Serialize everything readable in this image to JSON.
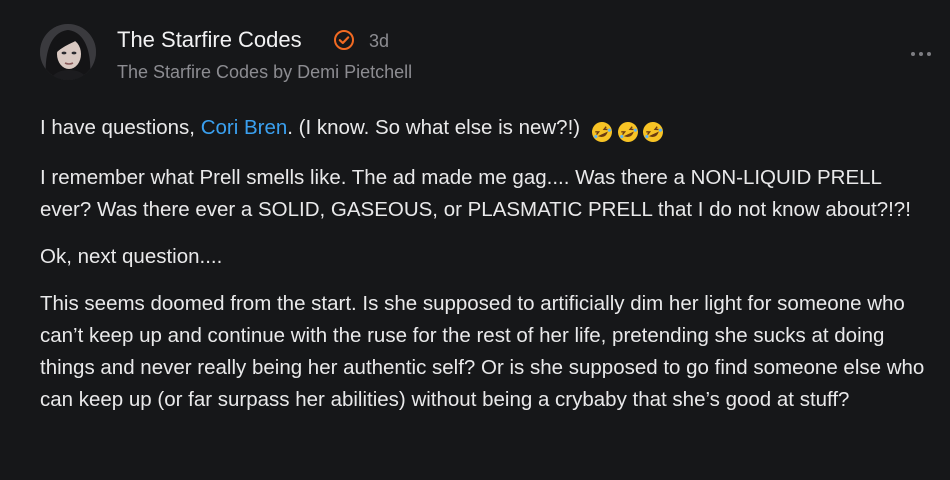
{
  "note": {
    "author": "The Starfire Codes",
    "timestamp": "3d",
    "byline": "The Starfire Codes by Demi Pietchell",
    "verified_color": "#f26a22",
    "menu_icon": "more-horizontal-icon"
  },
  "body": {
    "p1_prefix": "I have questions, ",
    "p1_mention": "Cori Bren",
    "p1_suffix": ". (I know. So what else is new?!)",
    "p1_emoji": "rolling-on-the-floor-laughing x3",
    "p2": "I remember what Prell smells like. The ad made me gag.... Was there a NON-LIQUID PRELL ever? Was there ever a SOLID, GASEOUS, or PLASMATIC PRELL that I do not know about?!?!",
    "p3": "Ok, next question....",
    "p4": "This seems doomed from the start. Is she supposed to artificially dim her light for someone who can’t keep up and continue with the ruse for the rest of her life, pretending she sucks at doing things and never really being her authentic self? Or is she supposed to go find someone else who can keep up (or far surpass her abilities) without being a crybaby that she’s good at stuff?"
  },
  "colors": {
    "background": "#161719",
    "text": "#e9e9ea",
    "muted": "#8c8c91",
    "link": "#3aa0f0"
  }
}
